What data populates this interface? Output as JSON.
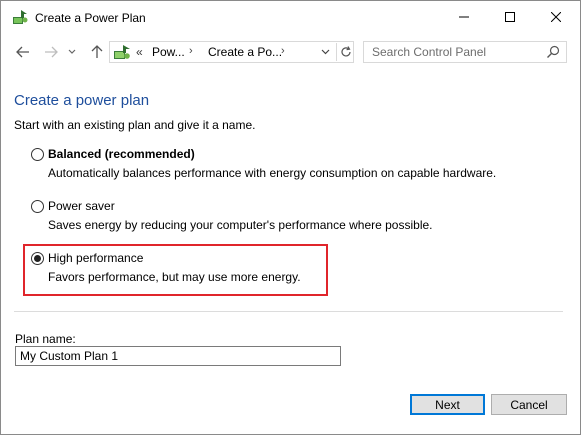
{
  "window": {
    "title": "Create a Power Plan",
    "title_icon": "power-options-icon"
  },
  "nav": {
    "back_icon": "arrow-left-icon",
    "forward_icon": "arrow-right-icon",
    "recent_icon": "chevron-down-icon",
    "up_icon": "arrow-up-icon"
  },
  "address": {
    "overflow": "«",
    "crumbs": [
      "Pow...",
      "Create a Po..."
    ],
    "separator": "›"
  },
  "search": {
    "placeholder": "Search Control Panel"
  },
  "content": {
    "heading": "Create a power plan",
    "intro": "Start with an existing plan and give it a name.",
    "options": [
      {
        "label": "Balanced (recommended)",
        "description": "Automatically balances performance with energy consumption on capable hardware.",
        "checked": false
      },
      {
        "label": "Power saver",
        "description": "Saves energy by reducing your computer's performance where possible.",
        "checked": false
      },
      {
        "label": "High performance",
        "description": "Favors performance, but may use more energy.",
        "checked": true
      }
    ],
    "plan_name_label": "Plan name:",
    "plan_name_value": "My Custom Plan 1"
  },
  "buttons": {
    "next": "Next",
    "cancel": "Cancel"
  },
  "colors": {
    "heading": "#1e4e9c",
    "highlight": "#e0252b",
    "focus": "#0078d7"
  }
}
